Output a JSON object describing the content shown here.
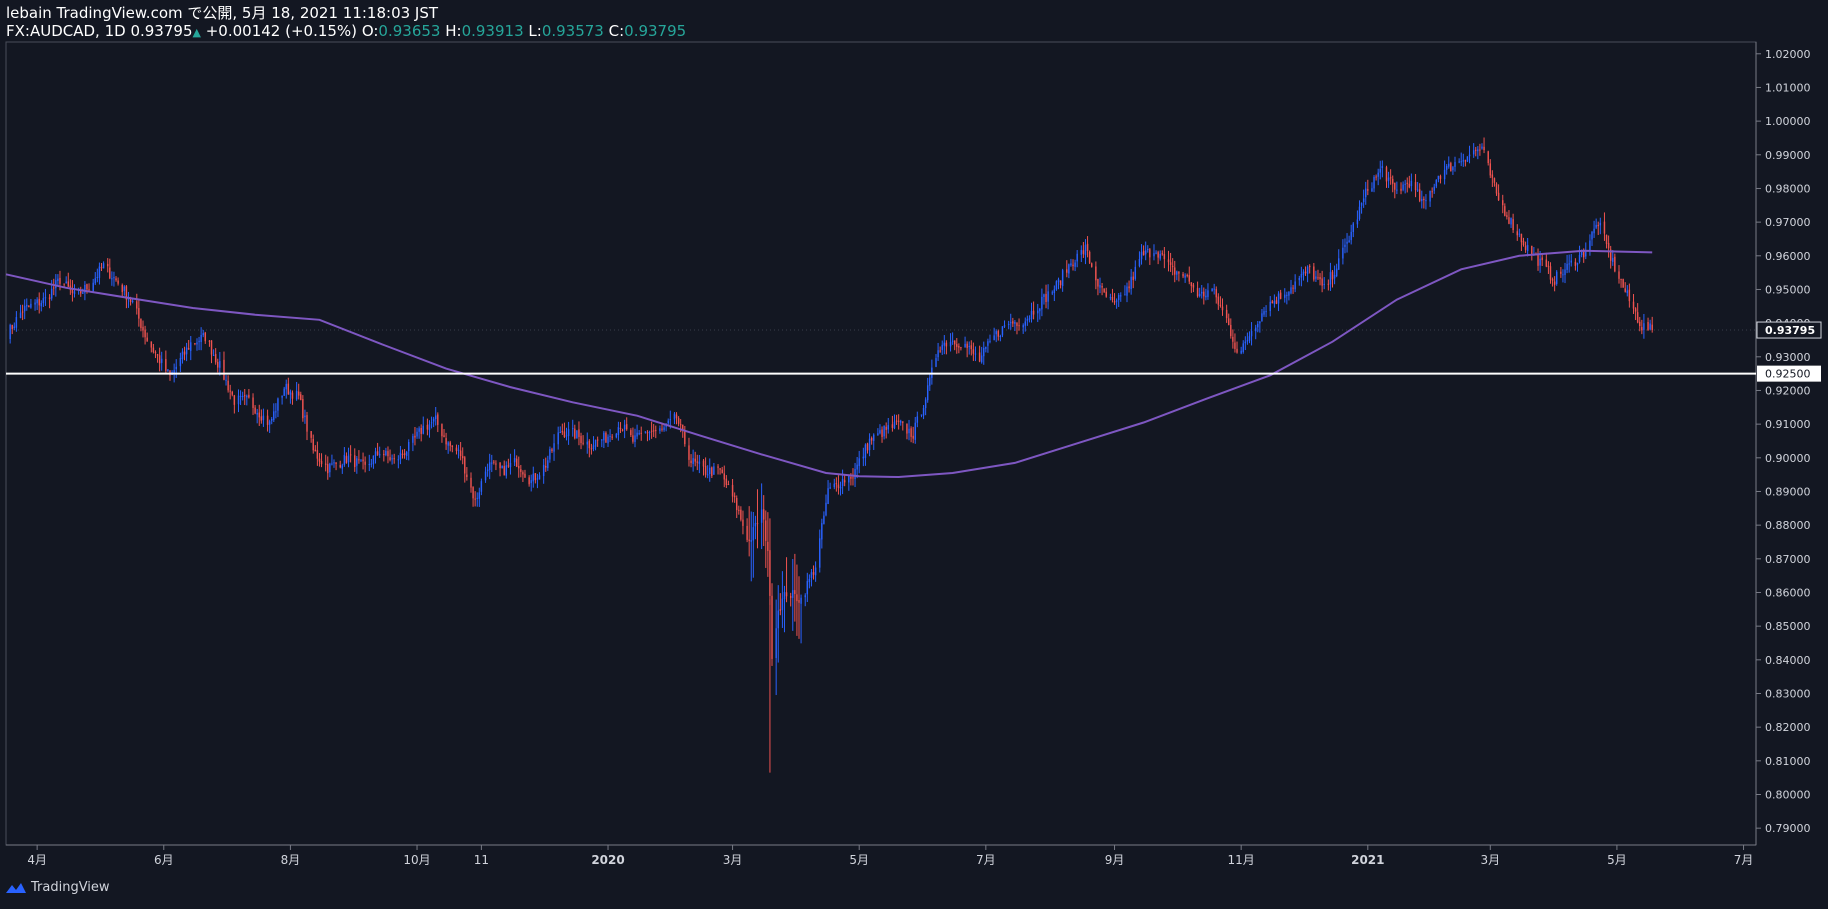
{
  "header": {
    "published": "lebain TradingView.com で公開, 5月 18, 2021 11:18:03 JST",
    "symbol": "FX:AUDCAD, 1D",
    "last": "0.93795",
    "change": "+0.00142 (+0.15%)",
    "o_label": "O:",
    "o_value": "0.93653",
    "h_label": "H:",
    "h_value": "0.93913",
    "l_label": "L:",
    "l_value": "0.93573",
    "c_label": "C:",
    "c_value": "0.93795"
  },
  "brand": {
    "name": "TradingView",
    "icon": "tradingview-logo-icon"
  },
  "colors": {
    "background": "#131722",
    "up": "#2962ff",
    "down": "#ef5350",
    "ma": "#7e57c2",
    "level": "#ffffff",
    "grid": "#363a45",
    "text": "#d1d4dc"
  },
  "chart_data": {
    "type": "candlestick",
    "ylim": [
      0.785,
      1.0235
    ],
    "yticks": [
      "1.02000",
      "1.01000",
      "1.00000",
      "0.99000",
      "0.98000",
      "0.97000",
      "0.96000",
      "0.95000",
      "0.94000",
      "0.93000",
      "0.92000",
      "0.91000",
      "0.90000",
      "0.89000",
      "0.88000",
      "0.87000",
      "0.86000",
      "0.85000",
      "0.84000",
      "0.83000",
      "0.82000",
      "0.81000",
      "0.80000",
      "0.79000"
    ],
    "xlim": [
      "2019-03-17",
      "2021-07-07"
    ],
    "xticks": [
      {
        "date": "2019-04-01",
        "label": "4月"
      },
      {
        "date": "2019-06-01",
        "label": "6月"
      },
      {
        "date": "2019-08-01",
        "label": "8月"
      },
      {
        "date": "2019-10-01",
        "label": "10月"
      },
      {
        "date": "2019-11-01",
        "label": "11"
      },
      {
        "date": "2020-01-01",
        "label": "2020"
      },
      {
        "date": "2020-03-01",
        "label": "3月"
      },
      {
        "date": "2020-05-01",
        "label": "5月"
      },
      {
        "date": "2020-07-01",
        "label": "7月"
      },
      {
        "date": "2020-09-01",
        "label": "9月"
      },
      {
        "date": "2020-11-01",
        "label": "11月"
      },
      {
        "date": "2021-01-01",
        "label": "2021"
      },
      {
        "date": "2021-03-01",
        "label": "3月"
      },
      {
        "date": "2021-05-01",
        "label": "5月"
      },
      {
        "date": "2021-07-01",
        "label": "7月"
      }
    ],
    "last_price": 0.93795,
    "last_price_label": "0.93795",
    "horizontal_level": 0.925,
    "horizontal_level_label": "0.92500",
    "close_path": [
      [
        "2019-03-18",
        0.937
      ],
      [
        "2019-03-25",
        0.944
      ],
      [
        "2019-04-05",
        0.947
      ],
      [
        "2019-04-12",
        0.953
      ],
      [
        "2019-04-19",
        0.948
      ],
      [
        "2019-04-26",
        0.951
      ],
      [
        "2019-05-03",
        0.957
      ],
      [
        "2019-05-10",
        0.952
      ],
      [
        "2019-05-17",
        0.946
      ],
      [
        "2019-05-24",
        0.935
      ],
      [
        "2019-06-04",
        0.924
      ],
      [
        "2019-06-14",
        0.934
      ],
      [
        "2019-06-21",
        0.936
      ],
      [
        "2019-06-28",
        0.927
      ],
      [
        "2019-07-05",
        0.917
      ],
      [
        "2019-07-12",
        0.917
      ],
      [
        "2019-07-22",
        0.91
      ],
      [
        "2019-07-29",
        0.921
      ],
      [
        "2019-08-05",
        0.918
      ],
      [
        "2019-08-12",
        0.902
      ],
      [
        "2019-08-19",
        0.897
      ],
      [
        "2019-08-29",
        0.9
      ],
      [
        "2019-09-06",
        0.897
      ],
      [
        "2019-09-13",
        0.902
      ],
      [
        "2019-09-20",
        0.899
      ],
      [
        "2019-09-27",
        0.903
      ],
      [
        "2019-10-04",
        0.909
      ],
      [
        "2019-10-10",
        0.911
      ],
      [
        "2019-10-16",
        0.904
      ],
      [
        "2019-10-22",
        0.901
      ],
      [
        "2019-10-29",
        0.887
      ],
      [
        "2019-11-04",
        0.898
      ],
      [
        "2019-11-11",
        0.896
      ],
      [
        "2019-11-18",
        0.899
      ],
      [
        "2019-11-25",
        0.893
      ],
      [
        "2019-12-02",
        0.898
      ],
      [
        "2019-12-09",
        0.908
      ],
      [
        "2019-12-16",
        0.907
      ],
      [
        "2019-12-23",
        0.904
      ],
      [
        "2019-12-31",
        0.906
      ],
      [
        "2020-01-07",
        0.91
      ],
      [
        "2020-01-13",
        0.905
      ],
      [
        "2020-01-20",
        0.908
      ],
      [
        "2020-01-27",
        0.908
      ],
      [
        "2020-02-03",
        0.912
      ],
      [
        "2020-02-10",
        0.899
      ],
      [
        "2020-02-17",
        0.896
      ],
      [
        "2020-02-24",
        0.896
      ],
      [
        "2020-03-02",
        0.887
      ],
      [
        "2020-03-09",
        0.875
      ],
      [
        "2020-03-15",
        0.884
      ],
      [
        "2020-03-18",
        0.873
      ],
      [
        "2020-03-20",
        0.842
      ],
      [
        "2020-03-23",
        0.855
      ],
      [
        "2020-03-27",
        0.86
      ],
      [
        "2020-04-03",
        0.858
      ],
      [
        "2020-04-10",
        0.868
      ],
      [
        "2020-04-16",
        0.89
      ],
      [
        "2020-04-22",
        0.893
      ],
      [
        "2020-04-28",
        0.895
      ],
      [
        "2020-05-06",
        0.905
      ],
      [
        "2020-05-13",
        0.908
      ],
      [
        "2020-05-20",
        0.91
      ],
      [
        "2020-05-27",
        0.907
      ],
      [
        "2020-06-03",
        0.92
      ],
      [
        "2020-06-08",
        0.933
      ],
      [
        "2020-06-14",
        0.935
      ],
      [
        "2020-06-20",
        0.934
      ],
      [
        "2020-06-28",
        0.929
      ],
      [
        "2020-07-05",
        0.936
      ],
      [
        "2020-07-12",
        0.94
      ],
      [
        "2020-07-20",
        0.941
      ],
      [
        "2020-07-27",
        0.946
      ],
      [
        "2020-08-04",
        0.951
      ],
      [
        "2020-08-11",
        0.958
      ],
      [
        "2020-08-18",
        0.962
      ],
      [
        "2020-08-25",
        0.95
      ],
      [
        "2020-09-01",
        0.945
      ],
      [
        "2020-09-08",
        0.951
      ],
      [
        "2020-09-14",
        0.96
      ],
      [
        "2020-09-21",
        0.962
      ],
      [
        "2020-09-28",
        0.956
      ],
      [
        "2020-10-05",
        0.954
      ],
      [
        "2020-10-12",
        0.948
      ],
      [
        "2020-10-18",
        0.95
      ],
      [
        "2020-10-25",
        0.941
      ],
      [
        "2020-10-31",
        0.93
      ],
      [
        "2020-11-06",
        0.938
      ],
      [
        "2020-11-13",
        0.945
      ],
      [
        "2020-11-20",
        0.948
      ],
      [
        "2020-11-27",
        0.952
      ],
      [
        "2020-12-04",
        0.956
      ],
      [
        "2020-12-11",
        0.95
      ],
      [
        "2020-12-18",
        0.958
      ],
      [
        "2020-12-24",
        0.967
      ],
      [
        "2021-01-01",
        0.98
      ],
      [
        "2021-01-08",
        0.986
      ],
      [
        "2021-01-14",
        0.979
      ],
      [
        "2021-01-21",
        0.982
      ],
      [
        "2021-01-28",
        0.975
      ],
      [
        "2021-02-04",
        0.984
      ],
      [
        "2021-02-11",
        0.987
      ],
      [
        "2021-02-18",
        0.99
      ],
      [
        "2021-02-25",
        0.992
      ],
      [
        "2021-03-04",
        0.978
      ],
      [
        "2021-03-11",
        0.97
      ],
      [
        "2021-03-18",
        0.963
      ],
      [
        "2021-03-25",
        0.958
      ],
      [
        "2021-04-01",
        0.953
      ],
      [
        "2021-04-08",
        0.957
      ],
      [
        "2021-04-15",
        0.961
      ],
      [
        "2021-04-22",
        0.97
      ],
      [
        "2021-04-29",
        0.958
      ],
      [
        "2021-05-06",
        0.948
      ],
      [
        "2021-05-13",
        0.939
      ],
      [
        "2021-05-18",
        0.93795
      ]
    ],
    "moving_average": {
      "points": [
        [
          "2019-03-17",
          0.9545
        ],
        [
          "2019-04-15",
          0.9505
        ],
        [
          "2019-05-15",
          0.9475
        ],
        [
          "2019-06-15",
          0.9445
        ],
        [
          "2019-07-15",
          0.9425
        ],
        [
          "2019-08-15",
          0.941
        ],
        [
          "2019-09-15",
          0.9335
        ],
        [
          "2019-10-15",
          0.9265
        ],
        [
          "2019-11-15",
          0.921
        ],
        [
          "2019-12-15",
          0.9165
        ],
        [
          "2020-01-15",
          0.9125
        ],
        [
          "2020-02-15",
          0.9065
        ],
        [
          "2020-03-15",
          0.901
        ],
        [
          "2020-04-15",
          0.8955
        ],
        [
          "2020-05-01",
          0.8945
        ],
        [
          "2020-05-20",
          0.8943
        ],
        [
          "2020-06-15",
          0.8955
        ],
        [
          "2020-07-15",
          0.8985
        ],
        [
          "2020-08-15",
          0.9045
        ],
        [
          "2020-09-15",
          0.9105
        ],
        [
          "2020-10-15",
          0.9175
        ],
        [
          "2020-11-15",
          0.9245
        ],
        [
          "2020-12-15",
          0.9345
        ],
        [
          "2021-01-15",
          0.947
        ],
        [
          "2021-02-15",
          0.956
        ],
        [
          "2021-03-15",
          0.96
        ],
        [
          "2021-04-15",
          0.9615
        ],
        [
          "2021-05-18",
          0.961
        ]
      ]
    }
  }
}
